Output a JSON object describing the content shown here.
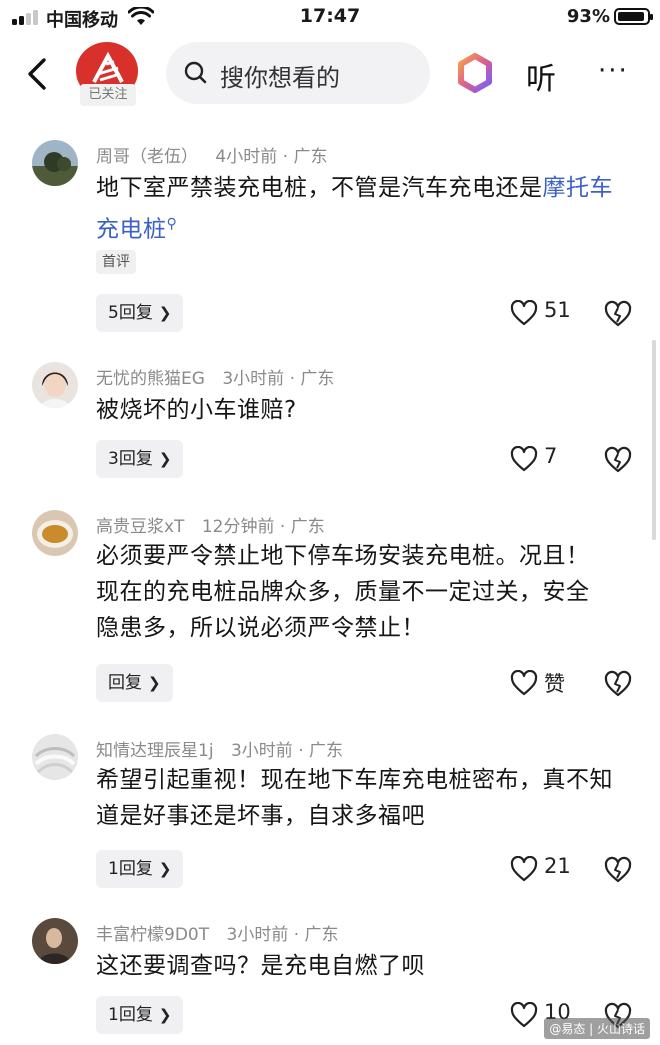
{
  "status_bar": {
    "carrier": "中国移动",
    "time": "17:47",
    "battery": "93%",
    "battery_level": 0.93
  },
  "header": {
    "followed_badge": "已关注",
    "search_placeholder": "搜你想看的",
    "listen_label": "听",
    "more_label": "···"
  },
  "comments": [
    {
      "user": "周哥（老伍）",
      "time": "4小时前",
      "location": "· 广东",
      "text_before": "地下室严禁装充电桩，不管是汽车充电还是",
      "text_link": "摩托车充电桩",
      "badge": "首评",
      "replies": "5回复",
      "likes": "51"
    },
    {
      "user": "无忧的熊猫EG",
      "time": "3小时前",
      "location": "· 广东",
      "text": "被烧坏的小车谁赔?",
      "replies": "3回复",
      "likes": "7"
    },
    {
      "user": "高贵豆浆xT",
      "time": "12分钟前",
      "location": "· 广东",
      "text": "必须要严令禁止地下停车场安装充电桩。况且！现在的充电桩品牌众多，质量不一定过关，安全隐患多，所以说必须严令禁止！",
      "replies": "回复",
      "likes": "赞"
    },
    {
      "user": "知情达理辰星1j",
      "time": "3小时前",
      "location": "· 广东",
      "text": "希望引起重视！现在地下车库充电桩密布，真不知道是好事还是坏事，自求多福吧",
      "replies": "1回复",
      "likes": "21"
    },
    {
      "user": "丰富柠檬9D0T",
      "time": "3小时前",
      "location": "· 广东",
      "text": "这还要调查吗？是充电自燃了呗",
      "replies": "1回复",
      "likes": "10"
    }
  ],
  "watermark": "@易态 | 火山诗话",
  "colors": {
    "link": "#3d62c6",
    "logo_red": "#d8302a",
    "meta_gray": "#8a8a8a"
  }
}
